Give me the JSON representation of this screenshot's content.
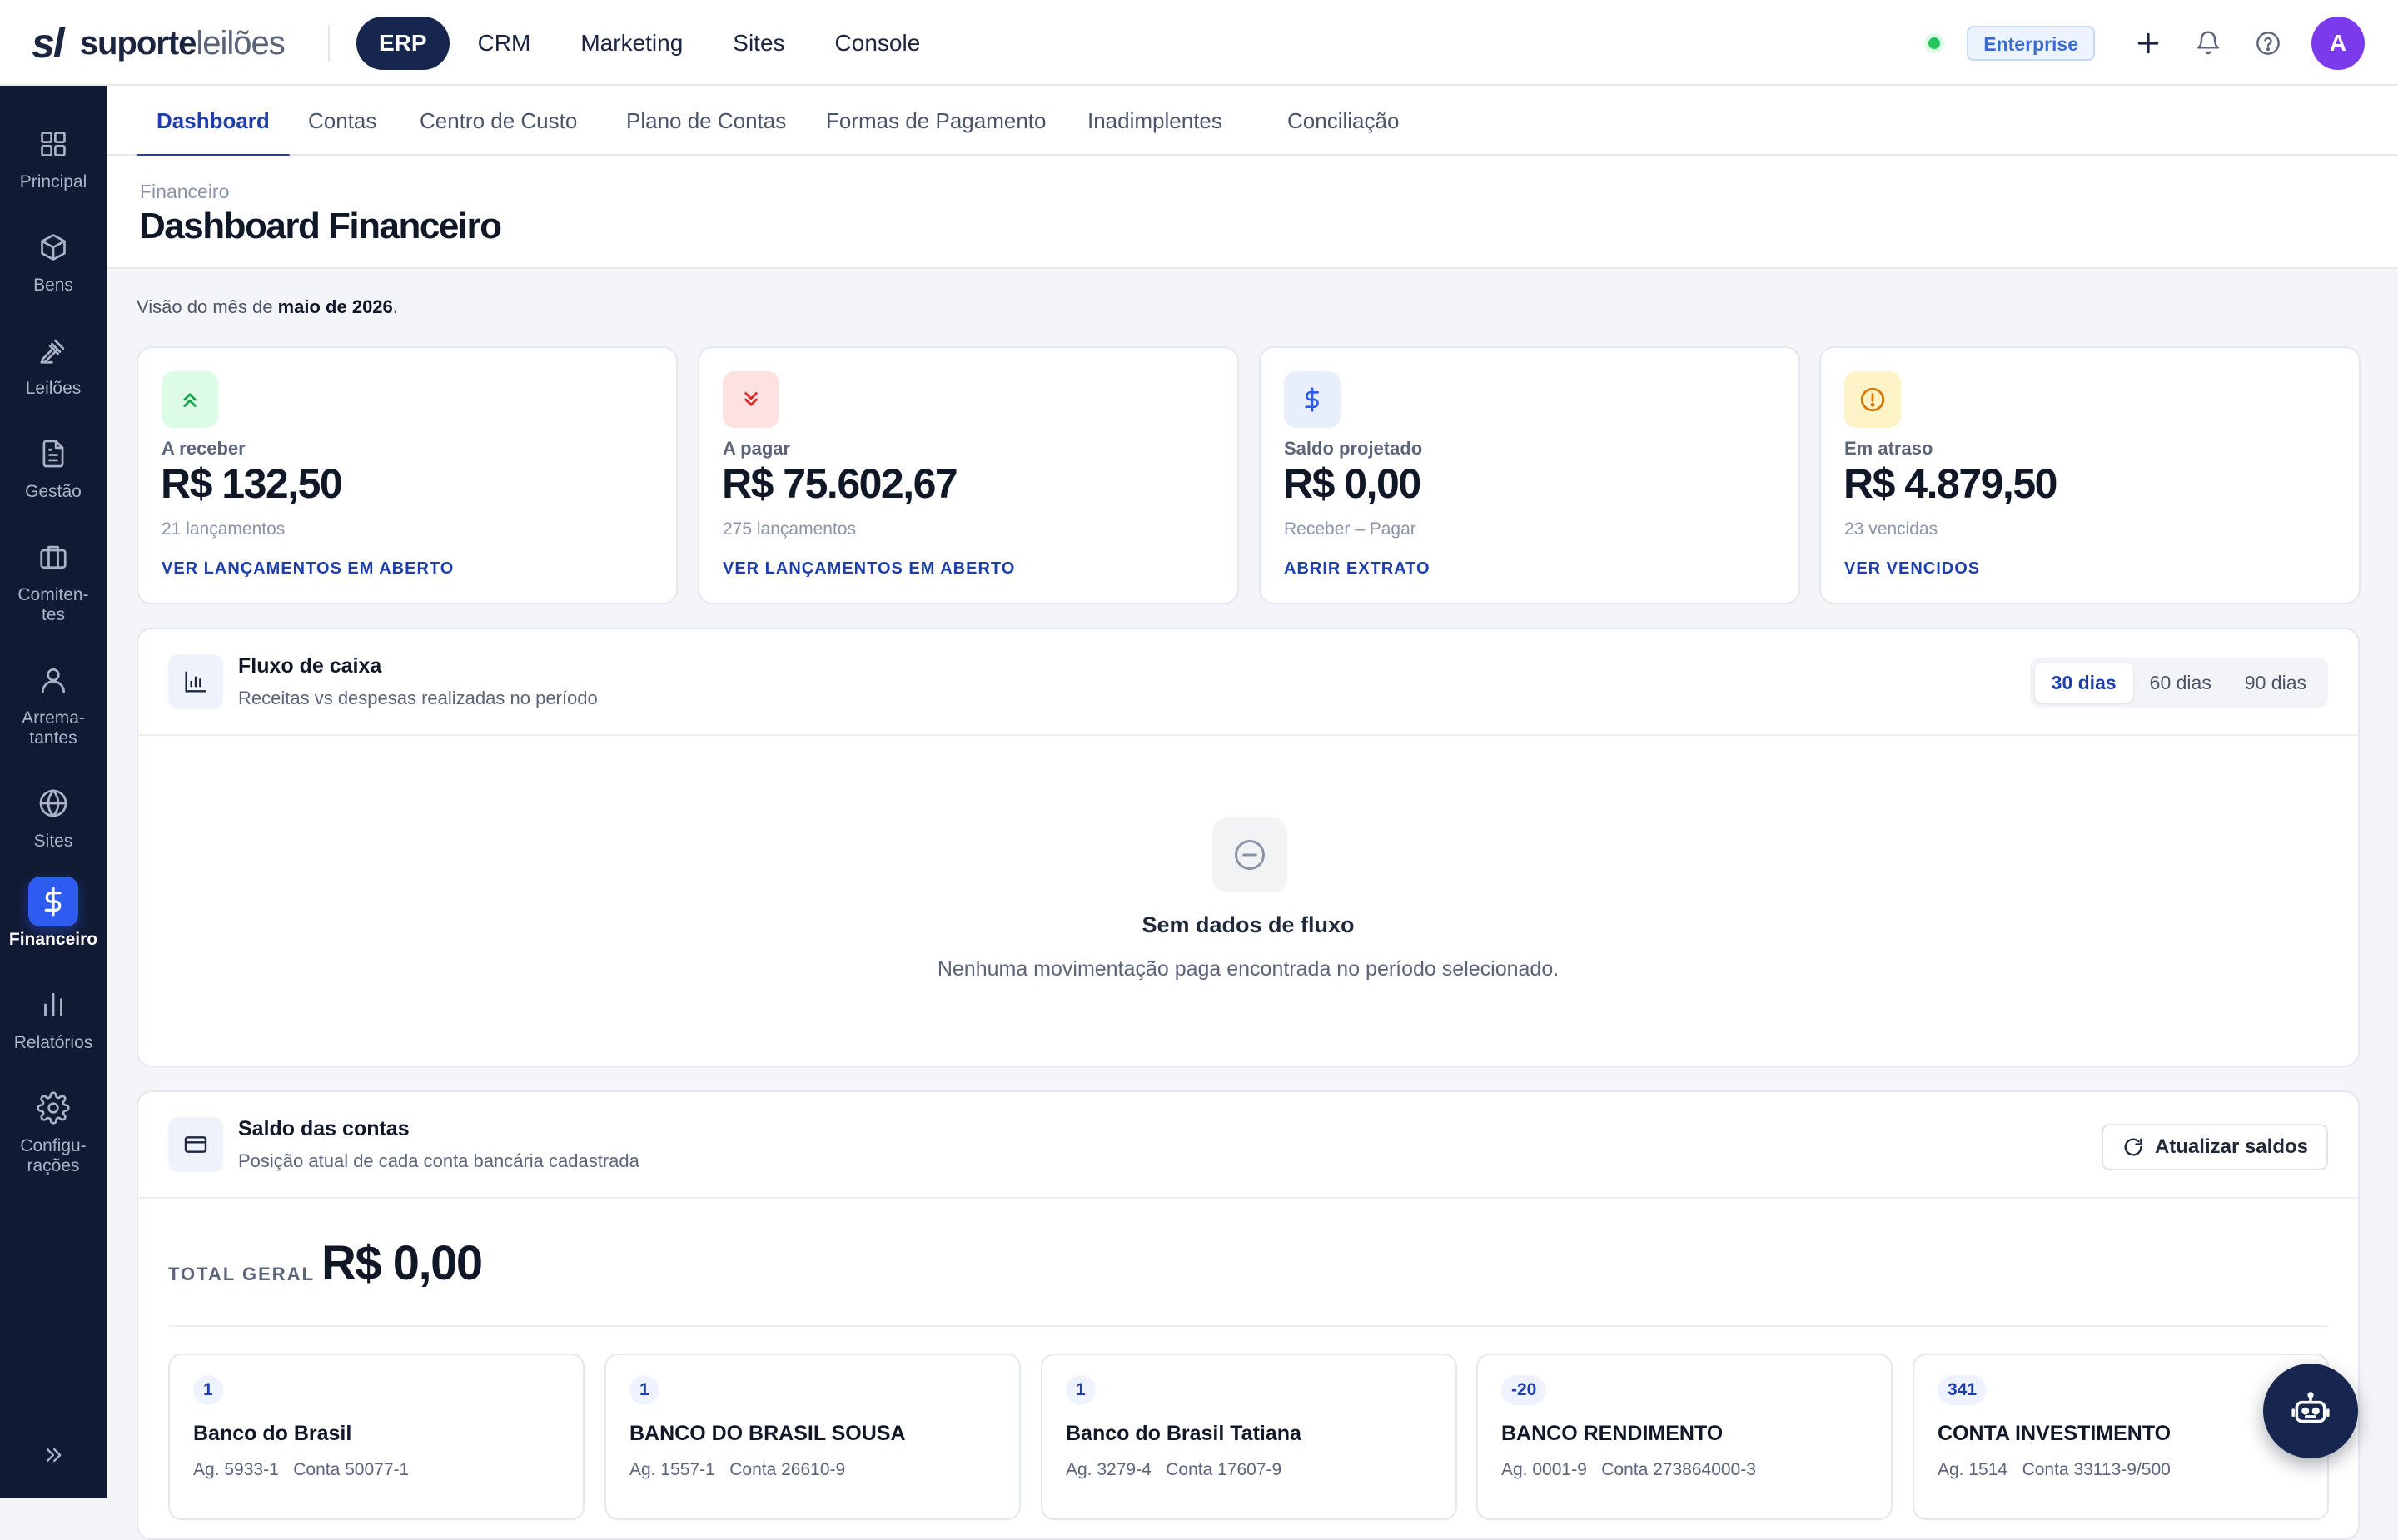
{
  "brand": {
    "mark": "sl",
    "name_a": "suporte",
    "name_b": "leilões"
  },
  "topnav": {
    "items": [
      {
        "label": "ERP",
        "active": true
      },
      {
        "label": "CRM"
      },
      {
        "label": "Marketing"
      },
      {
        "label": "Sites"
      },
      {
        "label": "Console"
      }
    ]
  },
  "topright": {
    "plan_badge": "Enterprise",
    "avatar_initial": "A",
    "status_color": "#22c55e"
  },
  "sidebar": {
    "items": [
      {
        "label": "Principal",
        "icon": "grid-icon"
      },
      {
        "label": "Bens",
        "icon": "box-icon"
      },
      {
        "label": "Leilões",
        "icon": "gavel-icon"
      },
      {
        "label": "Gestão",
        "icon": "document-icon"
      },
      {
        "label": "Comiten-\ntes",
        "icon": "briefcase-icon"
      },
      {
        "label": "Arrema-\ntantes",
        "icon": "user-icon"
      },
      {
        "label": "Sites",
        "icon": "globe-icon"
      },
      {
        "label": "Financeiro",
        "icon": "dollar-icon",
        "active": true
      },
      {
        "label": "Relatórios",
        "icon": "bar-chart-icon"
      },
      {
        "label": "Configu-\nrações",
        "icon": "gear-icon"
      }
    ]
  },
  "tabs": [
    {
      "label": "Dashboard",
      "active": true
    },
    {
      "label": "Contas"
    },
    {
      "label": "Centro de Custo"
    },
    {
      "label": "Plano de Contas"
    },
    {
      "label": "Formas de Pagamento"
    },
    {
      "label": "Inadimplentes"
    },
    {
      "label": "Conciliação"
    }
  ],
  "header": {
    "breadcrumb": "Financeiro",
    "title": "Dashboard Financeiro"
  },
  "intro": {
    "prefix": "Visão do mês de ",
    "month": "maio de 2026",
    "suffix": "."
  },
  "kpis": [
    {
      "label": "A receber",
      "value": "R$ 132,50",
      "sub": "21 lançamentos",
      "link": "VER LANÇAMENTOS EM ABERTO",
      "icon": "arrows-up-icon",
      "color": "#16a34a",
      "bg": "#dcfce7"
    },
    {
      "label": "A pagar",
      "value": "R$ 75.602,67",
      "sub": "275 lançamentos",
      "link": "VER LANÇAMENTOS EM ABERTO",
      "icon": "arrows-down-icon",
      "color": "#dc2626",
      "bg": "#fee2e2"
    },
    {
      "label": "Saldo projetado",
      "value": "R$ 0,00",
      "sub": "Receber – Pagar",
      "link": "ABRIR EXTRATO",
      "icon": "dollar-icon",
      "color": "#2e5bf0",
      "bg": "#e8eefc"
    },
    {
      "label": "Em atraso",
      "value": "R$ 4.879,50",
      "sub": "23 vencidas",
      "link": "VER VENCIDOS",
      "icon": "alert-circle-icon",
      "color": "#d97706",
      "bg": "#fef3c7"
    }
  ],
  "cashflow": {
    "title": "Fluxo de caixa",
    "subtitle": "Receitas vs despesas realizadas no período",
    "ranges": [
      {
        "label": "30 dias",
        "active": true
      },
      {
        "label": "60 dias"
      },
      {
        "label": "90 dias"
      }
    ],
    "empty_title": "Sem dados de fluxo",
    "empty_sub": "Nenhuma movimentação paga encontrada no período selecionado."
  },
  "balances": {
    "title": "Saldo das contas",
    "subtitle": "Posição atual de cada conta bancária cadastrada",
    "refresh_label": "Atualizar saldos",
    "total_label": "TOTAL GERAL",
    "total_value": "R$ 0,00",
    "accounts": [
      {
        "code": "1",
        "name": "Banco do Brasil",
        "info": "Ag. 5933-1   Conta 50077-1"
      },
      {
        "code": "1",
        "name": "BANCO DO BRASIL SOUSA",
        "info": "Ag. 1557-1   Conta 26610-9"
      },
      {
        "code": "1",
        "name": "Banco do Brasil Tatiana",
        "info": "Ag. 3279-4   Conta 17607-9"
      },
      {
        "code": "-20",
        "name": "BANCO RENDIMENTO",
        "info": "Ag. 0001-9   Conta 273864000-3"
      },
      {
        "code": "341",
        "name": "CONTA INVESTIMENTO",
        "info": "Ag. 1514   Conta 33113-9/500"
      }
    ]
  },
  "assistant": {
    "icon": "robot-icon"
  }
}
